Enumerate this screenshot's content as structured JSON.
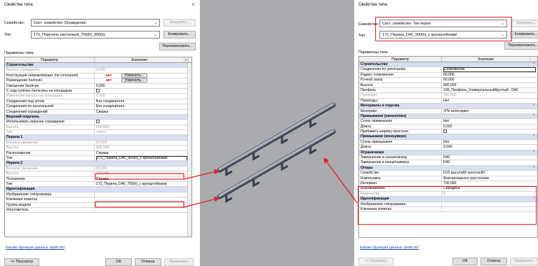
{
  "left_dialog": {
    "title": "Свойства типа",
    "family_label": "Семейство:",
    "family_value": "Сист. семейство: Ограждение",
    "type_label": "Тип:",
    "type_value": "170_Поручень настенный_700(h)_900(h)",
    "load_button": "Загрузить...",
    "copy_button": "Копировать...",
    "rename_button": "Переименовать...",
    "params_label": "Параметры типа",
    "col_param": "Параметр",
    "col_value": "Значение",
    "rows": [
      {
        "k": "Строительство",
        "v": "",
        "group": true
      },
      {
        "k": "Высота ограждения",
        "v": "0,000",
        "dim": true
      },
      {
        "k": "Конструкция направляющих (не сплошная)",
        "v": "",
        "red": "нет",
        "edit": "Изменить..."
      },
      {
        "k": "Размещение балясин",
        "v": "",
        "red": "нет",
        "edit": "Изменить..."
      },
      {
        "k": "Смещение балясин",
        "v": "0,000"
      },
      {
        "k": "С подступёнок балясины на площадках",
        "v": "",
        "check": true
      },
      {
        "k": "Изменение высоты на площадках",
        "v": "0,000",
        "dim": true
      },
      {
        "k": "Соединения под углом",
        "v": "Без соединителя"
      },
      {
        "k": "Соединения по касательной",
        "v": "Без соединителя"
      },
      {
        "k": "Соединения ограждений",
        "v": "Сварка"
      },
      {
        "k": "Верхний поручень",
        "v": "",
        "group": true
      },
      {
        "k": "Использовать верхнее ограждение",
        "v": "",
        "check": true
      },
      {
        "k": "Высота",
        "v": "600,000",
        "dim": true
      },
      {
        "k": "Тип",
        "v": "<Нет>",
        "dim": true
      },
      {
        "k": "Перила 1",
        "v": "",
        "group": true
      },
      {
        "k": "Боковое смещение",
        "v": "80,000",
        "dim": true
      },
      {
        "k": "Высота",
        "v": "900,000",
        "dim": true
      },
      {
        "k": "Расположение",
        "v": "Справа"
      },
      {
        "k": "Тип",
        "v": "172_Перила_D40_900(h)_с кронштейнами",
        "sel": true
      },
      {
        "k": "Перила 2",
        "v": "",
        "group": true
      },
      {
        "k": "Боковое смещение",
        "v": "80,000",
        "dim": true
      },
      {
        "k": "Высота",
        "v": "700,000",
        "dim": true
      },
      {
        "k": "Положение",
        "v": "Справа"
      },
      {
        "k": "Тип",
        "v": "172_Перила_D40_700(h)_с кронштейнами"
      },
      {
        "k": "Идентификация",
        "v": "",
        "group": true
      },
      {
        "k": "Изображение типоразмера",
        "v": ""
      },
      {
        "k": "Ключевая пометка",
        "v": ""
      },
      {
        "k": "Группа модели",
        "v": ""
      },
      {
        "k": "Изготовитель",
        "v": ""
      }
    ],
    "help_link": "Каково функция данных свойств?",
    "preview_button": "<< Просмотр",
    "ok_button": "ОК",
    "cancel_button": "Отмена",
    "apply_button": "Применить"
  },
  "right_dialog": {
    "title": "Свойства типа",
    "family_label": "Семейство:",
    "family_value": "Сист. семейство: Тип перил",
    "type_label": "Тип:",
    "type_value": "172_Перила_D40_900(h)_с кронштейнами",
    "load_button": "Загрузить...",
    "copy_button": "Копировать...",
    "rename_button": "Переименовать...",
    "params_label": "Параметры типа",
    "col_param": "Параметр",
    "col_value": "Значение",
    "rows": [
      {
        "k": "Строительство",
        "v": "",
        "group": true
      },
      {
        "k": "Соединение по умолчанию",
        "v": "Сопряжение",
        "sel": true
      },
      {
        "k": "Радиус сопряжения",
        "v": "50,000"
      },
      {
        "k": "Ручной зазор",
        "v": "60,000"
      },
      {
        "k": "Высота",
        "v": "900,000"
      },
      {
        "k": "Профиль",
        "v": "199_Профиль_УниверсальныйКруглый : D40"
      },
      {
        "k": "Проекция",
        "v": "100,000",
        "dim": true
      },
      {
        "k": "Переходы",
        "v": "Нет"
      },
      {
        "k": "Материалы и отделка",
        "v": "",
        "group": true
      },
      {
        "k": "Материал",
        "v": "<По категории>"
      },
      {
        "k": "Примыкание (начало/низ)",
        "v": "",
        "group": true
      },
      {
        "k": "Стиль примыкания",
        "v": "Нет"
      },
      {
        "k": "Длина",
        "v": "0,000"
      },
      {
        "k": "Прибавить ширину проступи",
        "v": "",
        "check": true
      },
      {
        "k": "Примыкание (конец/верх)",
        "v": "",
        "group": true
      },
      {
        "k": "Стиль примыкания",
        "v": "Нет"
      },
      {
        "k": "Длина",
        "v": "0,000"
      },
      {
        "k": "Ограничения",
        "v": "",
        "group": true
      },
      {
        "k": "Завершение в начале/внизу",
        "v": "D40"
      },
      {
        "k": "Завершение в конце/наверху",
        "v": "D40"
      },
      {
        "k": "Опоры",
        "v": "",
        "group": true
      },
      {
        "k": "Семейство",
        "v": "D15 высота60 консоль80"
      },
      {
        "k": "Компоновка",
        "v": "Фиксированное расстояние"
      },
      {
        "k": "Интервал",
        "v": "700,000"
      },
      {
        "k": "Выравнивание",
        "v": "Середина"
      },
      {
        "k": "Количество",
        "v": "0",
        "dim": true
      },
      {
        "k": "Идентификация",
        "v": "",
        "group": true
      },
      {
        "k": "Изображение типоразмера",
        "v": ""
      },
      {
        "k": "Ключевая пометка",
        "v": ""
      }
    ],
    "help_link": "Каково функция данных свойств?",
    "preview_button": "<< Просмотр",
    "ok_button": "ОК",
    "cancel_button": "Отмена",
    "apply_button": "Применить"
  },
  "colors": {
    "highlight": "#e0202a",
    "group_bg": "#d7dff0",
    "viewport_bg": "#a9abaf"
  }
}
